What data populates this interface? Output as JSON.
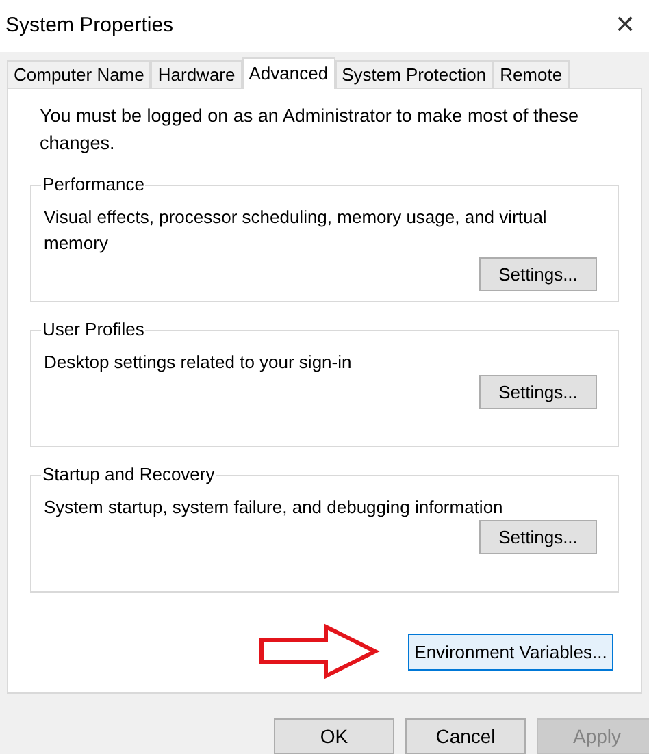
{
  "window": {
    "title": "System Properties",
    "close": "✕"
  },
  "tabs": [
    {
      "label": "Computer Name",
      "selected": false
    },
    {
      "label": "Hardware",
      "selected": false
    },
    {
      "label": "Advanced",
      "selected": true
    },
    {
      "label": "System Protection",
      "selected": false
    },
    {
      "label": "Remote",
      "selected": false
    }
  ],
  "notice": "You must be logged on as an Administrator to make most of these changes.",
  "groups": [
    {
      "title": "Performance",
      "description": "Visual effects, processor scheduling, memory usage, and virtual memory",
      "button": "Settings..."
    },
    {
      "title": "User Profiles",
      "description": "Desktop settings related to your sign-in",
      "button": "Settings..."
    },
    {
      "title": "Startup and Recovery",
      "description": "System startup, system failure, and debugging information",
      "button": "Settings..."
    }
  ],
  "environment_button": {
    "label": "Environment Variables...",
    "focused": true
  },
  "buttons": [
    {
      "label": "OK",
      "disabled": false
    },
    {
      "label": "Cancel",
      "disabled": false
    },
    {
      "label": "Apply",
      "disabled": true
    }
  ]
}
